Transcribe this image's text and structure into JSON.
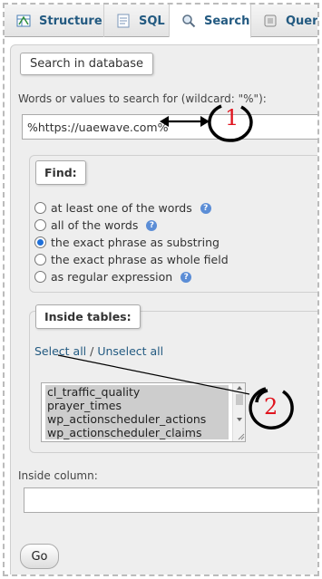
{
  "tabs": [
    {
      "label": "Structure",
      "icon": "structure-icon",
      "active": false
    },
    {
      "label": "SQL",
      "icon": "sql-icon",
      "active": false
    },
    {
      "label": "Search",
      "icon": "search-icon",
      "active": true
    },
    {
      "label": "Query",
      "icon": "query-icon",
      "active": false
    }
  ],
  "search": {
    "legend": "Search in database",
    "words_label": "Words or values to search for (wildcard: \"%\"):",
    "words_value": "%https://uaewave.com%"
  },
  "find": {
    "legend": "Find:",
    "options": [
      {
        "label": "at least one of the words",
        "checked": false,
        "help": true
      },
      {
        "label": "all of the words",
        "checked": false,
        "help": true
      },
      {
        "label": "the exact phrase as substring",
        "checked": true,
        "help": false
      },
      {
        "label": "the exact phrase as whole field",
        "checked": false,
        "help": false
      },
      {
        "label": "as regular expression",
        "checked": false,
        "help": true
      }
    ]
  },
  "tables": {
    "legend": "Inside tables:",
    "select_all": "Select all",
    "separator": " / ",
    "unselect_all": "Unselect all",
    "items": [
      "cl_traffic_quality",
      "prayer_times",
      "wp_actionscheduler_actions",
      "wp_actionscheduler_claims"
    ]
  },
  "column": {
    "label": "Inside column:",
    "value": ""
  },
  "go_label": "Go",
  "annotations": {
    "marker_1": "1",
    "marker_2": "2",
    "marker_color": "#e0141e"
  }
}
